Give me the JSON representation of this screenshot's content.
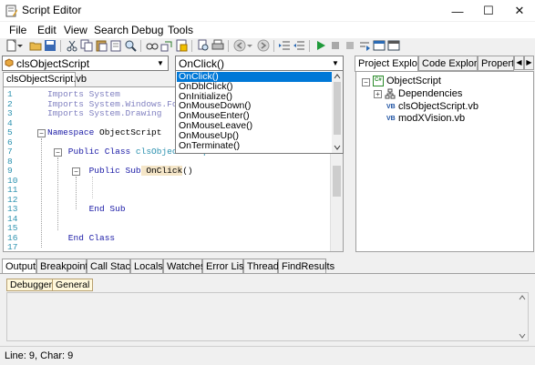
{
  "window": {
    "title": "Script Editor",
    "minimize": "—",
    "maximize": "☐",
    "close": "✕"
  },
  "menu": {
    "items": [
      "File",
      "Edit",
      "View",
      "Search",
      "Debug",
      "Tools"
    ]
  },
  "object_combo": {
    "value": "clsObjectScript"
  },
  "event_combo": {
    "value": "OnClick()"
  },
  "event_dropdown": {
    "options": [
      "OnClick()",
      "OnDblClick()",
      "OnInitialize()",
      "OnMouseDown()",
      "OnMouseEnter()",
      "OnMouseLeave()",
      "OnMouseUp()",
      "OnTerminate()"
    ],
    "selected_index": 0
  },
  "editor": {
    "tab": "clsObjectScript.vb",
    "lines": [
      {
        "n": "1",
        "segments": [
          {
            "t": "Imports",
            "c": "kwgray"
          },
          {
            "t": " System",
            "c": "kwgray"
          }
        ]
      },
      {
        "n": "2",
        "segments": [
          {
            "t": "Imports",
            "c": "kwgray"
          },
          {
            "t": " System.Windows.Forms",
            "c": "kwgray"
          }
        ]
      },
      {
        "n": "3",
        "segments": [
          {
            "t": "Imports",
            "c": "kwgray"
          },
          {
            "t": " System.Drawing",
            "c": "kwgray"
          }
        ]
      },
      {
        "n": "4",
        "segments": []
      },
      {
        "n": "5",
        "segments": [
          {
            "t": "Namespace",
            "c": "kw"
          },
          {
            "t": " ObjectScript",
            "c": ""
          }
        ]
      },
      {
        "n": "6",
        "segments": []
      },
      {
        "n": "7",
        "segments": [
          {
            "t": "    Public Class",
            "c": "kw"
          },
          {
            "t": " clsObjectScript",
            "c": "cls"
          }
        ]
      },
      {
        "n": "8",
        "segments": []
      },
      {
        "n": "9",
        "segments": [
          {
            "t": "        Public Sub",
            "c": "kw"
          },
          {
            "t": " OnClick",
            "c": "hl"
          },
          {
            "t": "()",
            "c": ""
          }
        ]
      },
      {
        "n": "10",
        "segments": []
      },
      {
        "n": "11",
        "segments": []
      },
      {
        "n": "12",
        "segments": []
      },
      {
        "n": "13",
        "segments": [
          {
            "t": "        End Sub",
            "c": "kw"
          }
        ]
      },
      {
        "n": "14",
        "segments": []
      },
      {
        "n": "15",
        "segments": []
      },
      {
        "n": "16",
        "segments": [
          {
            "t": "    End Class",
            "c": "kw"
          }
        ]
      },
      {
        "n": "17",
        "segments": []
      }
    ]
  },
  "right_pane": {
    "tabs": [
      "Project Explorer",
      "Code Explorer",
      "Propert"
    ],
    "active_tab": 0,
    "tree": {
      "root": "ObjectScript",
      "root_badge": "C#",
      "children": [
        {
          "label": "Dependencies",
          "icon": "dependencies-icon",
          "expander": "+"
        },
        {
          "label": "clsObjectScript.vb",
          "icon": "vb-file-icon",
          "badge": "VB"
        },
        {
          "label": "modXVision.vb",
          "icon": "vb-file-icon",
          "badge": "VB"
        }
      ]
    }
  },
  "bottom_tabs": [
    "Output",
    "Breakpoints",
    "Call Stack",
    "Locals",
    "Watches",
    "Error List",
    "Threads",
    "FindResults"
  ],
  "output": {
    "filters": [
      "Debugger",
      "General"
    ]
  },
  "status": {
    "text": "Line: 9, Char: 9"
  }
}
